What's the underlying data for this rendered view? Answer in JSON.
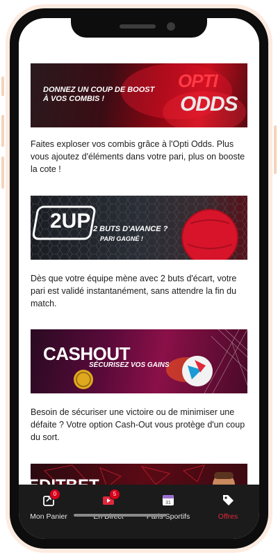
{
  "promos": [
    {
      "banner_line1": "DONNEZ UN COUP DE BOOST",
      "banner_line2": "À VOS COMBIS !",
      "logo_top": "OPTI",
      "logo_bottom": "ODDS",
      "description": "Faites exploser vos combis grâce à l'Opti Odds. Plus vous ajoutez d'éléments dans votre pari, plus on booste la cote !"
    },
    {
      "logo": "2UP",
      "banner_line1": "2 BUTS D'AVANCE ?",
      "banner_line2": "PARI GAGNÉ !",
      "description": "Dès que votre équipe mène avec 2 buts d'écart, votre pari est validé instantanément, sans attendre la fin du match."
    },
    {
      "logo": "CASHOUT",
      "banner_line1": "SÉCURISEZ VOS GAINS",
      "description": "Besoin de sécuriser une victoire ou de minimiser une défaite ? Votre option Cash-Out vous protège d'un coup du sort."
    },
    {
      "logo_partial": "EDITBET"
    }
  ],
  "tabs": [
    {
      "label": "Mon Panier",
      "icon": "basket-icon",
      "badge": "0",
      "active": false
    },
    {
      "label": "En Direct",
      "icon": "live-icon",
      "badge": "5",
      "active": false
    },
    {
      "label": "Paris Sportifs",
      "icon": "calendar-icon",
      "calendar_day": "31",
      "active": false
    },
    {
      "label": "Offres",
      "icon": "tag-icon",
      "active": true
    }
  ],
  "colors": {
    "accent": "#d9001b",
    "tab_bar": "#1b1b1b",
    "active_tab": "#e0283c",
    "text": "#1c1c1c"
  }
}
